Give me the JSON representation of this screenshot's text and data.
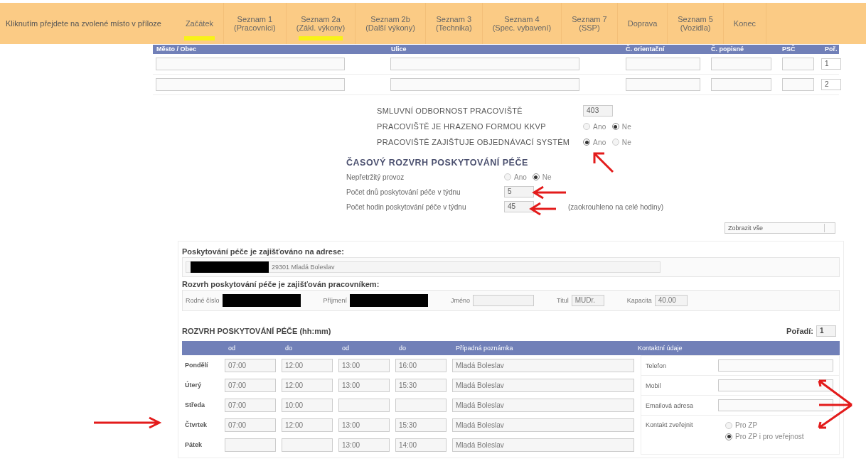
{
  "nav": {
    "hint": "Kliknutím přejdete na zvolené místo v příloze",
    "items": [
      {
        "label": "Začátek",
        "highlighted": true
      },
      {
        "label": "Seznam 1\n(Pracovníci)",
        "highlighted": false
      },
      {
        "label": "Seznam 2a\n(Zákl. výkony)",
        "highlighted": true
      },
      {
        "label": "Seznam 2b\n(Další výkony)",
        "highlighted": false
      },
      {
        "label": "Seznam 3\n(Technika)",
        "highlighted": false
      },
      {
        "label": "Seznam 4\n(Spec. vybavení)",
        "highlighted": false
      },
      {
        "label": "Seznam 7\n(SSP)",
        "highlighted": false
      },
      {
        "label": "Doprava",
        "highlighted": false
      },
      {
        "label": "Seznam 5\n(Vozidla)",
        "highlighted": false
      },
      {
        "label": "Konec",
        "highlighted": false
      }
    ]
  },
  "address_table": {
    "columns": [
      "Město / Obec",
      "Ulice",
      "Č. orientační",
      "Č. popisné",
      "PSČ",
      "Poř."
    ],
    "rows": [
      {
        "order": "1"
      },
      {
        "order": "2"
      }
    ]
  },
  "workplace": {
    "fields": [
      {
        "kind": "text",
        "label": "SMLUVNÍ ODBORNOST PRACOVIŠTĚ",
        "value": "403"
      },
      {
        "kind": "radio",
        "label": "PRACOVIŠTĚ JE HRAZENO FORMOU KKVP",
        "options": [
          {
            "label": "Ano",
            "selected": false
          },
          {
            "label": "Ne",
            "selected": true
          }
        ]
      },
      {
        "kind": "radio",
        "label": "PRACOVIŠTĚ ZAJIŠŤUJE OBJEDNÁVACÍ SYSTÉM",
        "options": [
          {
            "label": "Ano",
            "selected": true
          },
          {
            "label": "Ne",
            "selected": false
          }
        ]
      }
    ]
  },
  "schedule_summary": {
    "title": "ČASOVÝ ROZVRH POSKYTOVÁNÍ PÉČE",
    "fields": [
      {
        "kind": "radio",
        "label": "Nepřetržitý provoz",
        "options": [
          {
            "label": "Ano",
            "selected": false
          },
          {
            "label": "Ne",
            "selected": true
          }
        ]
      },
      {
        "kind": "text",
        "label": "Počet dnů poskytování péče v týdnu",
        "value": "5"
      },
      {
        "kind": "text",
        "label": "Počet hodin poskytování péče v týdnu",
        "value": "45",
        "note": "(zaokrouhleno na celé hodiny)"
      }
    ]
  },
  "filter": {
    "value": "Zobrazit vše"
  },
  "care_address": {
    "title": "Poskytování péče je zajišťováno na adrese:",
    "redacted": true,
    "value": "29301 Mladá Boleslav"
  },
  "worker": {
    "title": "Rozvrh poskytování péče je zajišťován pracovníkem:",
    "fields": [
      {
        "label": "Rodné číslo",
        "redacted": true
      },
      {
        "label": "Příjmení",
        "redacted": true
      },
      {
        "label": "Jméno"
      },
      {
        "label": "Titul",
        "value": "MUDr."
      },
      {
        "label": "Kapacita",
        "value": "40.00"
      }
    ]
  },
  "timetable": {
    "title": "ROZVRH POSKYTOVÁNÍ PÉČE (hh:mm)",
    "order_label": "Pořadí:",
    "order": "1",
    "columns": [
      "od",
      "do",
      "od",
      "do",
      "Případná poznámka"
    ],
    "contact_title": "Kontaktní údaje",
    "rows": [
      {
        "day": "Pondělí",
        "from_1": "07:00",
        "to_1": "12:00",
        "from_2": "13:00",
        "to_2": "16:00",
        "note": "Mladá Boleslav"
      },
      {
        "day": "Úterý",
        "from_1": "07:00",
        "to_1": "12:00",
        "from_2": "13:00",
        "to_2": "15:30",
        "note": "Mladá Boleslav"
      },
      {
        "day": "Středa",
        "from_1": "07:00",
        "to_1": "10:00",
        "note": "Mladá Boleslav"
      },
      {
        "day": "Čtvrtek",
        "from_1": "07:00",
        "to_1": "12:00",
        "from_2": "13:00",
        "to_2": "15:30",
        "note": "Mladá Boleslav"
      },
      {
        "day": "Pátek",
        "from_2": "13:00",
        "to_2": "14:00",
        "note": "Mladá Boleslav"
      }
    ],
    "contacts": [
      {
        "label": "Telefon"
      },
      {
        "label": "Mobil"
      },
      {
        "label": "Emailová adresa"
      }
    ],
    "publish": {
      "label": "Kontakt zveřejnit",
      "options": [
        {
          "label": "Pro ZP",
          "selected": false
        },
        {
          "label": "Pro ZP i pro veřejnost",
          "selected": true
        }
      ]
    }
  }
}
